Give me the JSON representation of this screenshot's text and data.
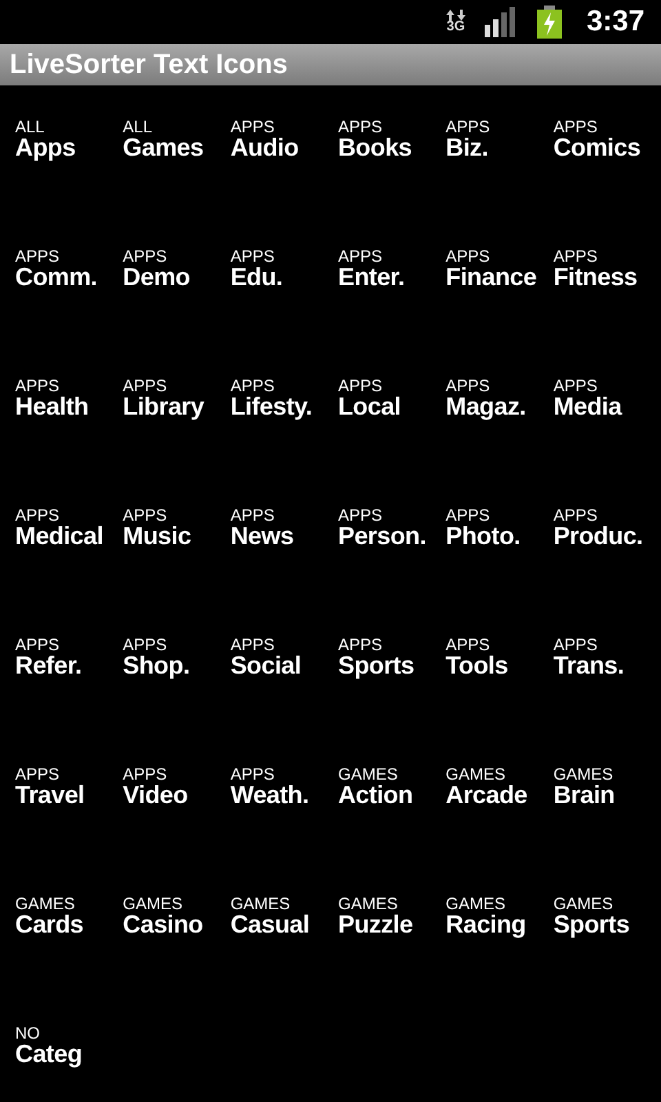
{
  "status_bar": {
    "network": "3G",
    "time": "3:37"
  },
  "title_bar": {
    "title": "LiveSorter Text Icons"
  },
  "icons": [
    {
      "group": "ALL",
      "label": "Apps"
    },
    {
      "group": "ALL",
      "label": "Games"
    },
    {
      "group": "APPS",
      "label": "Audio"
    },
    {
      "group": "APPS",
      "label": "Books"
    },
    {
      "group": "APPS",
      "label": "Biz."
    },
    {
      "group": "APPS",
      "label": "Comics"
    },
    {
      "group": "APPS",
      "label": "Comm."
    },
    {
      "group": "APPS",
      "label": "Demo"
    },
    {
      "group": "APPS",
      "label": "Edu."
    },
    {
      "group": "APPS",
      "label": "Enter."
    },
    {
      "group": "APPS",
      "label": "Finance"
    },
    {
      "group": "APPS",
      "label": "Fitness"
    },
    {
      "group": "APPS",
      "label": "Health"
    },
    {
      "group": "APPS",
      "label": "Library"
    },
    {
      "group": "APPS",
      "label": "Lifesty."
    },
    {
      "group": "APPS",
      "label": "Local"
    },
    {
      "group": "APPS",
      "label": "Magaz."
    },
    {
      "group": "APPS",
      "label": "Media"
    },
    {
      "group": "APPS",
      "label": "Medical"
    },
    {
      "group": "APPS",
      "label": "Music"
    },
    {
      "group": "APPS",
      "label": "News"
    },
    {
      "group": "APPS",
      "label": "Person."
    },
    {
      "group": "APPS",
      "label": "Photo."
    },
    {
      "group": "APPS",
      "label": "Produc."
    },
    {
      "group": "APPS",
      "label": "Refer."
    },
    {
      "group": "APPS",
      "label": "Shop."
    },
    {
      "group": "APPS",
      "label": "Social"
    },
    {
      "group": "APPS",
      "label": "Sports"
    },
    {
      "group": "APPS",
      "label": "Tools"
    },
    {
      "group": "APPS",
      "label": "Trans."
    },
    {
      "group": "APPS",
      "label": "Travel"
    },
    {
      "group": "APPS",
      "label": "Video"
    },
    {
      "group": "APPS",
      "label": "Weath."
    },
    {
      "group": "GAMES",
      "label": "Action"
    },
    {
      "group": "GAMES",
      "label": "Arcade"
    },
    {
      "group": "GAMES",
      "label": "Brain"
    },
    {
      "group": "GAMES",
      "label": "Cards"
    },
    {
      "group": "GAMES",
      "label": "Casino"
    },
    {
      "group": "GAMES",
      "label": "Casual"
    },
    {
      "group": "GAMES",
      "label": "Puzzle"
    },
    {
      "group": "GAMES",
      "label": "Racing"
    },
    {
      "group": "GAMES",
      "label": "Sports"
    },
    {
      "group": "NO",
      "label": "Categ"
    }
  ]
}
